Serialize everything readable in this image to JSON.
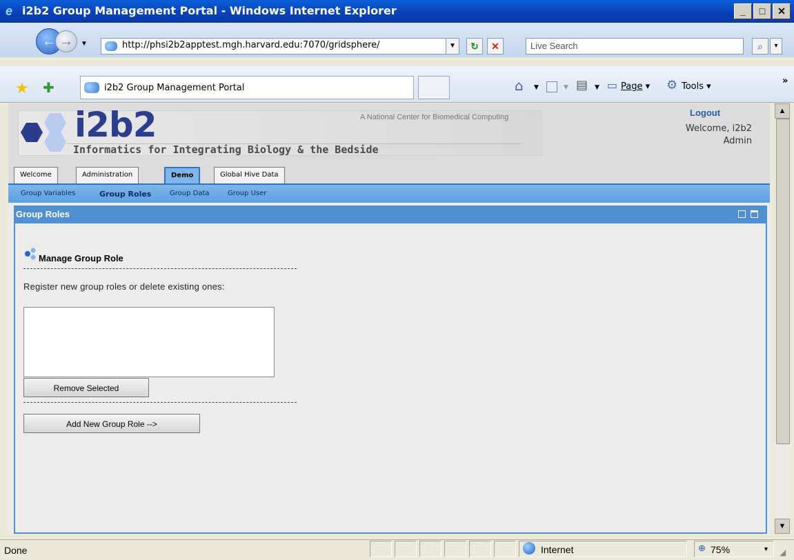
{
  "window": {
    "title": "i2b2 Group Management Portal - Windows Internet Explorer"
  },
  "browser": {
    "address": "http://phsi2b2apptest.mgh.harvard.edu:7070/gridsphere/",
    "search_placeholder": "Live Search",
    "tab_title": "i2b2 Group Management Portal",
    "page_label": "Page",
    "tools_label": "Tools"
  },
  "header": {
    "logo": "i2b2",
    "subtitle": "Informatics for Integrating Biology & the Bedside",
    "center": "A National Center for Biomedical Computing",
    "logout": "Logout",
    "welcome_line1": "Welcome, i2b2",
    "welcome_line2": "Admin"
  },
  "tabs": [
    {
      "label": "Welcome"
    },
    {
      "label": "Administration"
    },
    {
      "label": "Demo"
    },
    {
      "label": "Global Hive Data"
    }
  ],
  "subnav": [
    {
      "label": "Group Variables"
    },
    {
      "label": "Group Roles"
    },
    {
      "label": "Group Data"
    },
    {
      "label": "Group User"
    }
  ],
  "panel": {
    "title": "Group Roles",
    "section_title": "Manage Group Role",
    "instruction": "Register new group roles or delete existing ones:",
    "remove_button": "Remove Selected",
    "add_button": "Add New Group Role -->"
  },
  "status": {
    "text": "Done",
    "zone": "Internet",
    "zoom": "75%"
  }
}
